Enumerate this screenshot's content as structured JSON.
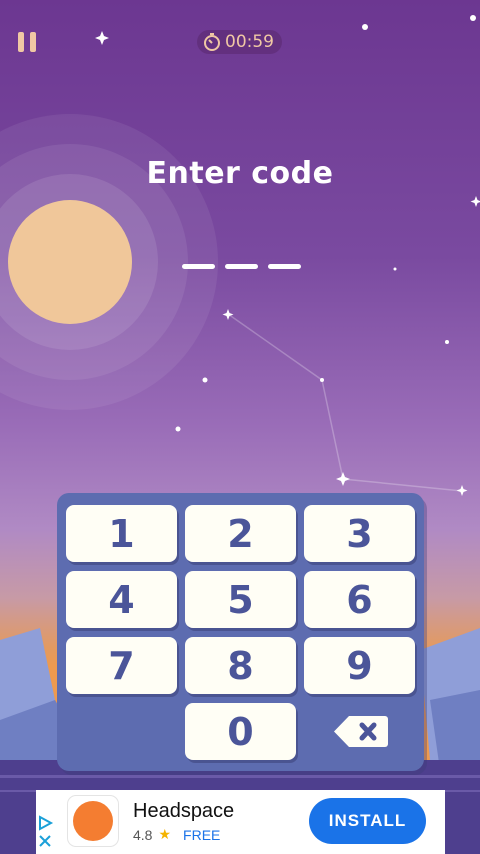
{
  "timer": {
    "text": "00:59"
  },
  "prompt": {
    "title": "Enter code",
    "code_length": 3,
    "entered": ""
  },
  "keypad": {
    "keys": [
      "1",
      "2",
      "3",
      "4",
      "5",
      "6",
      "7",
      "8",
      "9",
      "0"
    ],
    "backspace_icon": "backspace-icon"
  },
  "ad": {
    "app_name": "Headspace",
    "rating": "4.8",
    "rating_icon": "★",
    "price": "FREE",
    "install_label": "INSTALL"
  },
  "colors": {
    "sky_top": "#6c3791",
    "sun": "#f0c79a",
    "keypad": "#5d6cb0",
    "key_text": "#4b5599",
    "install": "#1a73e8"
  }
}
